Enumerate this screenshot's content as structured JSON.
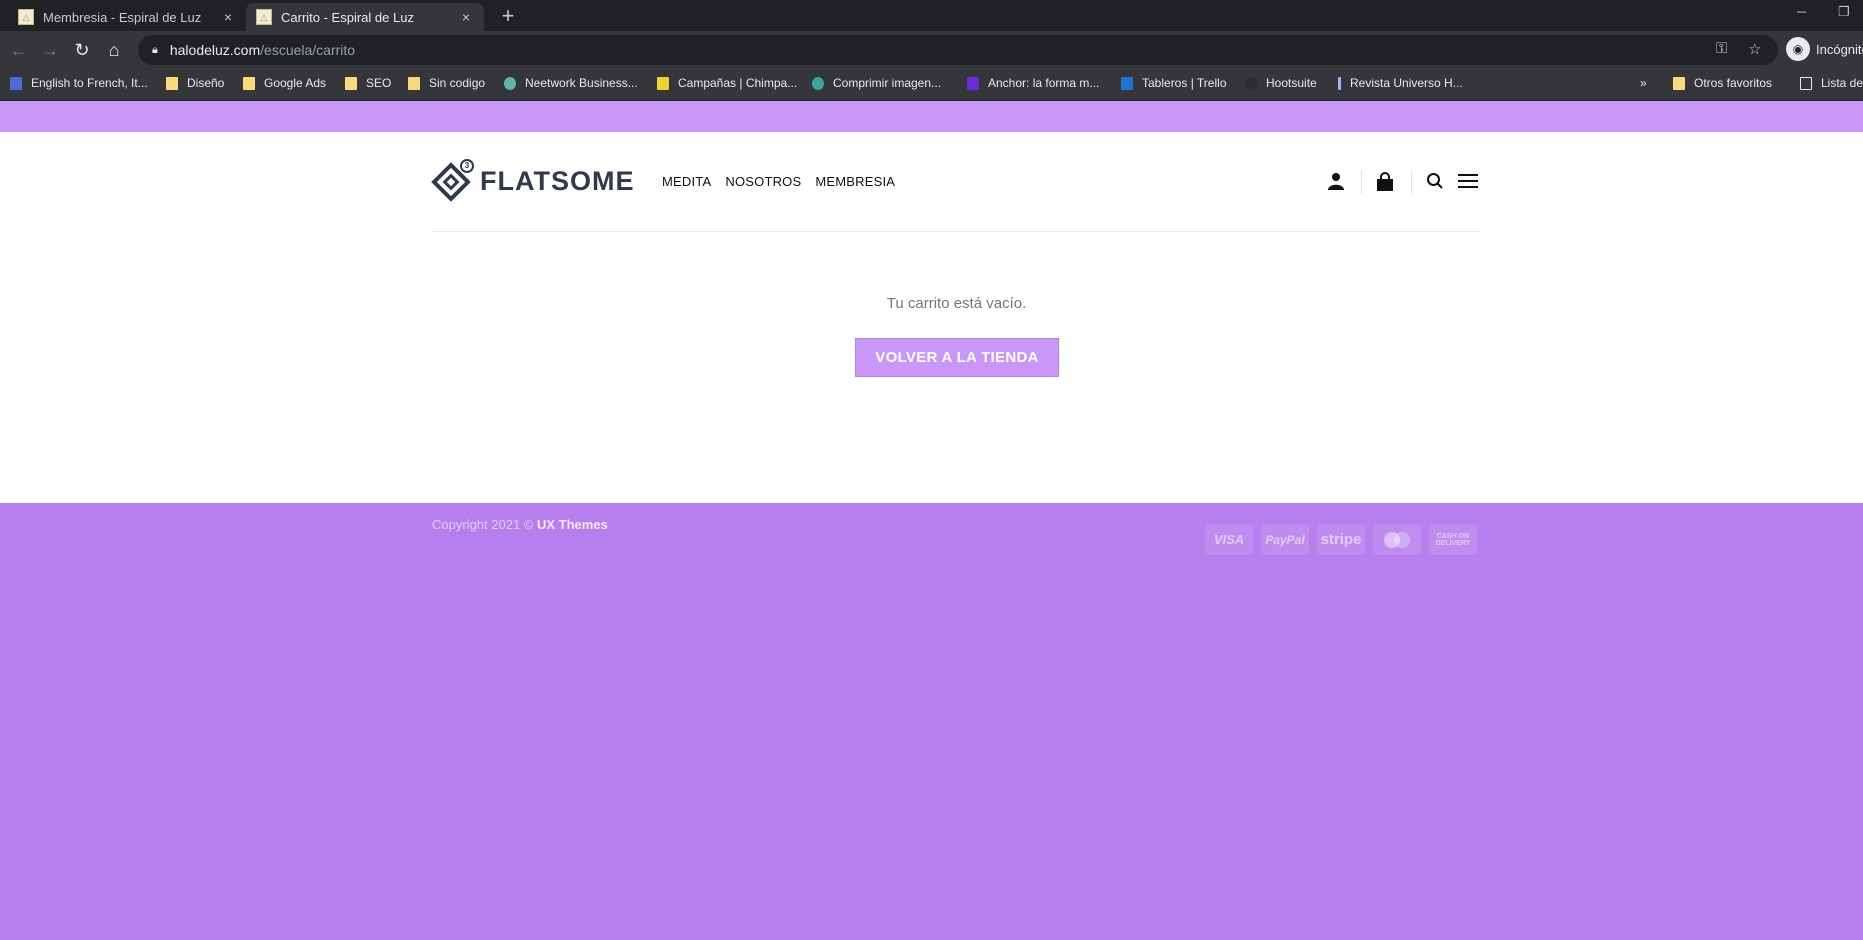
{
  "browser": {
    "tabs": [
      {
        "title": "Membresia - Espiral de Luz",
        "close": "×"
      },
      {
        "title": "Carrito - Espiral de Luz",
        "close": "×"
      }
    ],
    "new_tab": "+",
    "url_host": "halodeluz.com",
    "url_path": "/escuela/carrito",
    "incognito_label": "Incógnito",
    "bookmarks": [
      "English to French, It...",
      "Diseño",
      "Google Ads",
      "SEO",
      "Sin codigo",
      "Neetwork Business...",
      "Campañas | Chimpa...",
      "Comprimir imagen...",
      "Anchor: la forma m...",
      "Tableros | Trello",
      "Hootsuite",
      "Revista Universo H..."
    ],
    "bookmarks_overflow": "»",
    "other_bookmarks": "Otros favoritos",
    "reading_list": "Lista de"
  },
  "site": {
    "logo_text": "FLATSOME",
    "logo_badge": "3",
    "nav": [
      "MEDITA",
      "NOSOTROS",
      "MEMBRESIA"
    ]
  },
  "cart": {
    "empty_message": "Tu carrito está vacío.",
    "return_button": "VOLVER A LA TIENDA"
  },
  "footer": {
    "copyright_prefix": "Copyright 2021 © ",
    "copyright_brand": "UX Themes",
    "payments": [
      "VISA",
      "PayPal",
      "stripe",
      "MasterCard",
      "CASH ON DELIVERY"
    ]
  },
  "colors": {
    "accent": "#c897f7",
    "footer_bg": "#b77eed",
    "logo": "#2f3a4c"
  }
}
